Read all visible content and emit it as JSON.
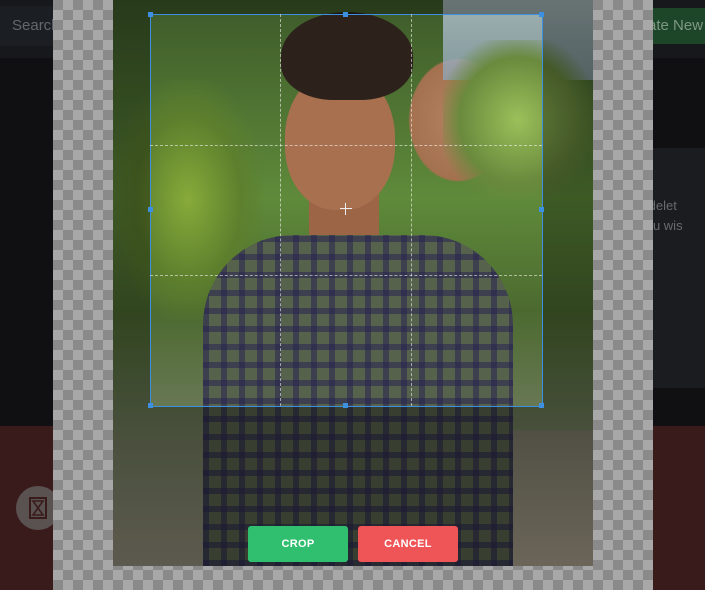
{
  "background": {
    "search_placeholder": "Search",
    "create_label": "ate New",
    "card_text_line1": "tly delet",
    "card_text_line2": "t you wis",
    "fab_icon": "hourglass-icon"
  },
  "cropper": {
    "crop_label": "CROP",
    "cancel_label": "CANCEL",
    "accent_color": "#3d8fe0",
    "crop_button_color": "#2fbf6e",
    "cancel_button_color": "#ef5457"
  }
}
